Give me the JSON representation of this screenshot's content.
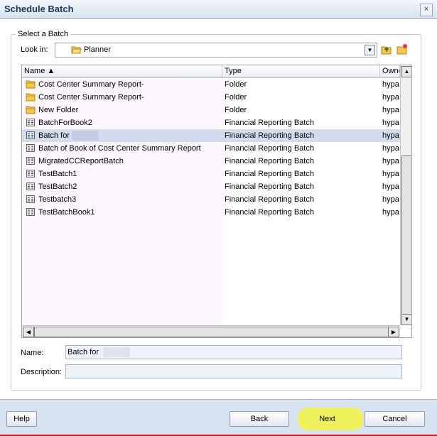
{
  "window": {
    "title": "Schedule Batch",
    "close_glyph": "×"
  },
  "group": {
    "label": "Select a Batch"
  },
  "lookin": {
    "label": "Look in:",
    "value": "Planner"
  },
  "columns": [
    {
      "label": "Name ▲"
    },
    {
      "label": "Type"
    },
    {
      "label": "Owne"
    }
  ],
  "rows": [
    {
      "name": "Cost Center Summary Report-",
      "type": "Folder",
      "owner": "hypa",
      "icon": "folder-icon"
    },
    {
      "name": "Cost Center Summary Report-",
      "type": "Folder",
      "owner": "hypa",
      "icon": "folder-icon"
    },
    {
      "name": "New Folder",
      "type": "Folder",
      "owner": "hypa",
      "icon": "folder-icon"
    },
    {
      "name": "BatchForBook2",
      "type": "Financial Reporting Batch",
      "owner": "hypa",
      "icon": "batch-icon"
    },
    {
      "name": "Batch for",
      "type": "Financial Reporting Batch",
      "owner": "hypa",
      "icon": "batch-icon",
      "selected": true
    },
    {
      "name": "Batch of Book of Cost Center Summary Report",
      "type": "Financial Reporting Batch",
      "owner": "hypa",
      "icon": "batch-icon"
    },
    {
      "name": "MigratedCCReportBatch",
      "type": "Financial Reporting Batch",
      "owner": "hypa",
      "icon": "batch-icon"
    },
    {
      "name": "TestBatch1",
      "type": "Financial Reporting Batch",
      "owner": "hypa",
      "icon": "batch-icon"
    },
    {
      "name": "TestBatch2",
      "type": "Financial Reporting Batch",
      "owner": "hypa",
      "icon": "batch-icon"
    },
    {
      "name": "Testbatch3",
      "type": "Financial Reporting Batch",
      "owner": "hypa",
      "icon": "batch-icon"
    },
    {
      "name": "TestBatchBook1",
      "type": "Financial Reporting Batch",
      "owner": "hypa",
      "icon": "batch-icon"
    }
  ],
  "name_field": {
    "label": "Name:",
    "value": "Batch for"
  },
  "description_field": {
    "label": "Description:",
    "value": ""
  },
  "buttons": {
    "help": "Help",
    "back": "Back",
    "next": "Next",
    "cancel": "Cancel"
  },
  "colors": {
    "selection": "#d3dcec",
    "footer": "#d7e3f1",
    "highlight": "#f2f24a",
    "folder": "#f2c94c"
  }
}
